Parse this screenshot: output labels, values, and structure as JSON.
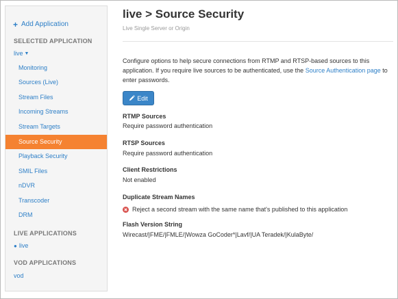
{
  "sidebar": {
    "add_application": "Add Application",
    "selected_heading": "SELECTED APPLICATION",
    "selected_app": "live",
    "nav_items": [
      {
        "label": "Monitoring",
        "active": false
      },
      {
        "label": "Sources (Live)",
        "active": false
      },
      {
        "label": "Stream Files",
        "active": false
      },
      {
        "label": "Incoming Streams",
        "active": false
      },
      {
        "label": "Stream Targets",
        "active": false
      },
      {
        "label": "Source Security",
        "active": true
      },
      {
        "label": "Playback Security",
        "active": false
      },
      {
        "label": "SMIL Files",
        "active": false
      },
      {
        "label": "nDVR",
        "active": false
      },
      {
        "label": "Transcoder",
        "active": false
      },
      {
        "label": "DRM",
        "active": false
      }
    ],
    "live_heading": "LIVE APPLICATIONS",
    "live_app": "live",
    "vod_heading": "VOD APPLICATIONS",
    "vod_app": "vod"
  },
  "main": {
    "title": "live > Source Security",
    "subtitle": "Live Single Server or Origin",
    "intro_part1": "Configure options to help secure connections from RTMP and RTSP-based sources to this application. If you require live sources to be authenticated, use the",
    "intro_link": "Source Authentication page",
    "intro_part2": "to enter passwords.",
    "edit_label": "Edit",
    "fields": {
      "rtmp_label": "RTMP Sources",
      "rtmp_value": "Require password authentication",
      "rtsp_label": "RTSP Sources",
      "rtsp_value": "Require password authentication",
      "client_label": "Client Restrictions",
      "client_value": "Not enabled",
      "dup_label": "Duplicate Stream Names",
      "dup_value": "Reject a second stream with the same name that's published to this application",
      "flash_label": "Flash Version String",
      "flash_value": "Wirecast/|FME/|FMLE/|Wowza GoCoder*|Lavf/|UA Teradek/|KulaByte/"
    }
  },
  "colors": {
    "accent": "#f58231",
    "link": "#2d7fc7",
    "button": "#3b86c8",
    "reject": "#d9534f"
  }
}
